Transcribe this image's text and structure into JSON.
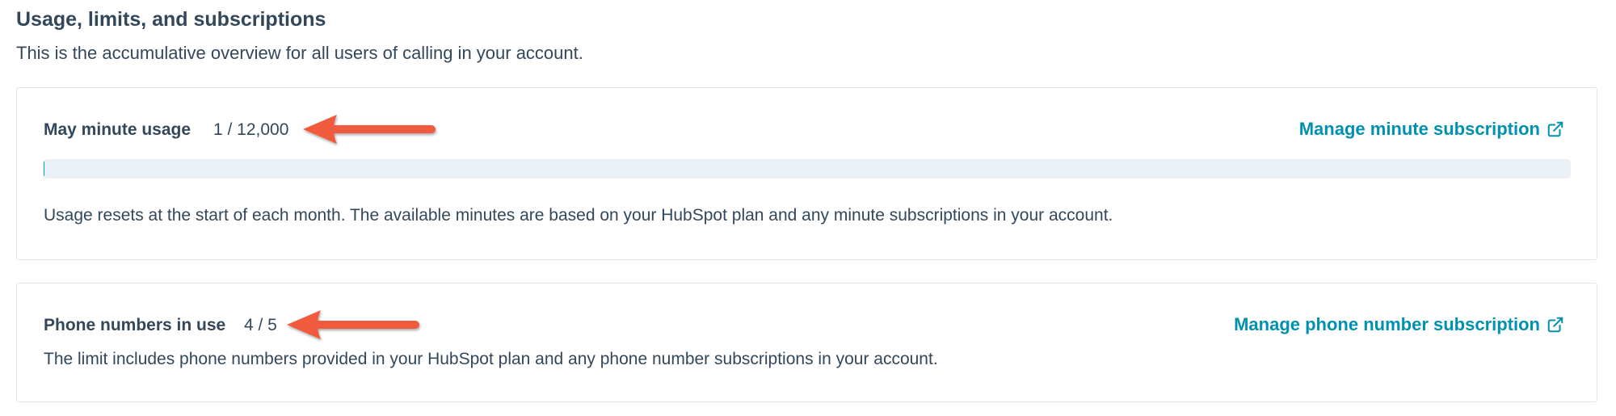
{
  "section": {
    "title": "Usage, limits, and subscriptions",
    "description": "This is the accumulative overview for all users of calling in your account."
  },
  "minutes_card": {
    "label": "May minute usage",
    "value": "1 / 12,000",
    "used": 1,
    "limit": 12000,
    "progress_fraction": 8.33e-05,
    "manage_link": "Manage minute subscription",
    "note": "Usage resets at the start of each month. The available minutes are based on your HubSpot plan and any minute subscriptions in your account."
  },
  "phones_card": {
    "label": "Phone numbers in use",
    "value": "4 / 5",
    "manage_link": "Manage phone number subscription",
    "note": "The limit includes phone numbers provided in your HubSpot plan and any phone number subscriptions in your account."
  },
  "icons": {
    "external_link": "external-link-icon",
    "annotation_arrow": "arrow-left-icon"
  },
  "colors": {
    "text": "#33475b",
    "link": "#0091ae",
    "track": "#eaf0f6",
    "border": "#dfe3eb",
    "annotation_arrow": "#f05a3c"
  }
}
